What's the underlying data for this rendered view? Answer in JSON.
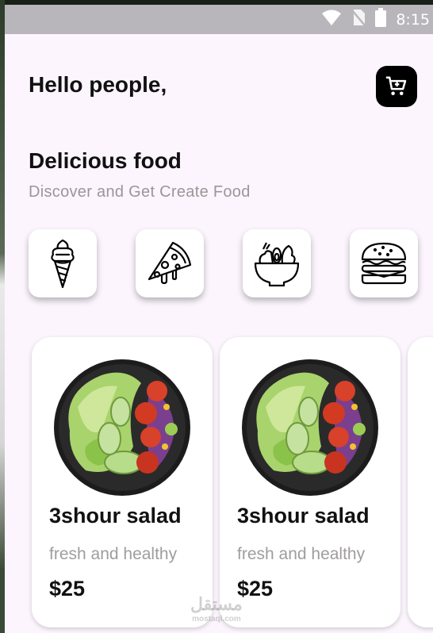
{
  "statusbar": {
    "time": "8:15",
    "icons": [
      "wifi-icon",
      "no-sim-icon",
      "battery-icon"
    ]
  },
  "header": {
    "greeting": "Hello people,",
    "cart_icon": "cart-icon"
  },
  "hero": {
    "title": "Delicious food",
    "subtitle": "Discover and Get Create Food"
  },
  "categories": [
    {
      "icon": "ice-cream-icon"
    },
    {
      "icon": "pizza-slice-icon"
    },
    {
      "icon": "salad-bowl-icon"
    },
    {
      "icon": "burger-icon"
    }
  ],
  "items": [
    {
      "title": "3shour salad",
      "description": "fresh and healthy",
      "price": "$25"
    },
    {
      "title": "3shour salad",
      "description": "fresh and healthy",
      "price": "$25"
    }
  ],
  "watermark": {
    "text": "مستقل",
    "sub": "mostaql.com"
  },
  "colors": {
    "background": "#fcf5fd",
    "status_bar": "#b8b6ba",
    "cart_button": "#000000",
    "muted_text": "#9a9699"
  }
}
